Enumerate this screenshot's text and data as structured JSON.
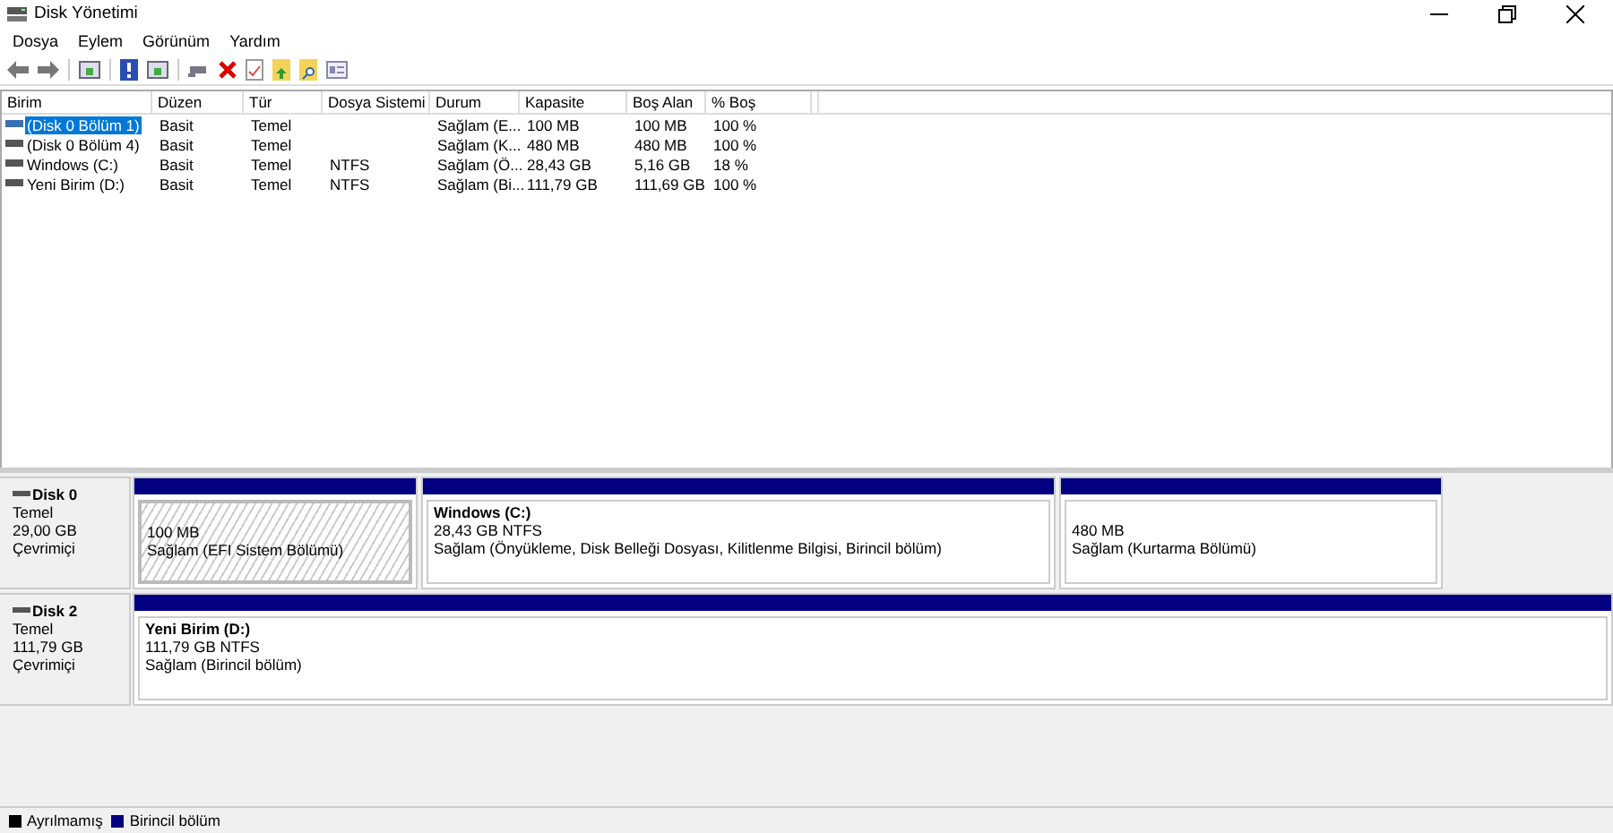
{
  "window": {
    "title": "Disk Yönetimi"
  },
  "menu": [
    "Dosya",
    "Eylem",
    "Görünüm",
    "Yardım"
  ],
  "table": {
    "columns": [
      "Birim",
      "Düzen",
      "Tür",
      "Dosya Sistemi",
      "Durum",
      "Kapasite",
      "Boş Alan",
      "% Boş"
    ],
    "rows": [
      {
        "selected": true,
        "cells": [
          "(Disk 0 Bölüm 1)",
          "Basit",
          "Temel",
          "",
          "Sağlam (E...",
          "100 MB",
          "100 MB",
          "100 %"
        ]
      },
      {
        "selected": false,
        "cells": [
          "(Disk 0 Bölüm 4)",
          "Basit",
          "Temel",
          "",
          "Sağlam (K...",
          "480 MB",
          "480 MB",
          "100 %"
        ]
      },
      {
        "selected": false,
        "cells": [
          "Windows (C:)",
          "Basit",
          "Temel",
          "NTFS",
          "Sağlam (Ö...",
          "28,43 GB",
          "5,16 GB",
          "18 %"
        ]
      },
      {
        "selected": false,
        "cells": [
          "Yeni Birim (D:)",
          "Basit",
          "Temel",
          "NTFS",
          "Sağlam (Bi...",
          "111,79 GB",
          "111,69 GB",
          "100 %"
        ]
      }
    ]
  },
  "disks": [
    {
      "name": "Disk 0",
      "type": "Temel",
      "size": "29,00 GB",
      "status": "Çevrimiçi",
      "partitions": [
        {
          "kind": "efi",
          "size": "100 MB",
          "status": "Sağlam (EFI Sistem Bölümü)"
        },
        {
          "kind": "primary",
          "name": "Windows  (C:)",
          "size": "28,43 GB NTFS",
          "status": "Sağlam (Önyükleme, Disk Belleği Dosyası, Kilitlenme Bilgisi, Birincil bölüm)"
        },
        {
          "kind": "primary",
          "size": "480 MB",
          "status": "Sağlam (Kurtarma Bölümü)"
        }
      ]
    },
    {
      "name": "Disk 2",
      "type": "Temel",
      "size": "111,79 GB",
      "status": "Çevrimiçi",
      "partitions": [
        {
          "kind": "primary",
          "name": "Yeni Birim  (D:)",
          "size": "111,79 GB NTFS",
          "status": "Sağlam (Birincil bölüm)"
        }
      ]
    }
  ],
  "legend": [
    {
      "label": "Ayrılmamış",
      "color": "#000000"
    },
    {
      "label": "Birincil bölüm",
      "color": "#000080"
    }
  ]
}
